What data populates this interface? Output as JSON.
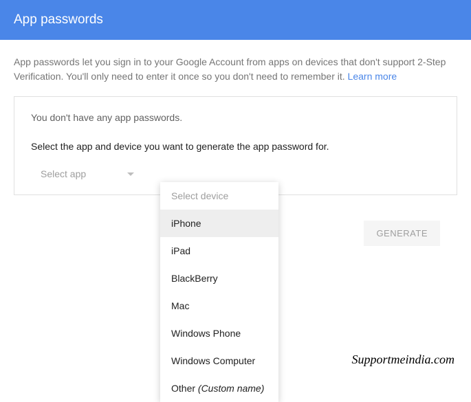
{
  "header": {
    "title": "App passwords"
  },
  "description": {
    "text": "App passwords let you sign in to your Google Account from apps on devices that don't support 2-Step Verification. You'll only need to enter it once so you don't need to remember it. ",
    "learn_more": "Learn more"
  },
  "card": {
    "no_passwords_msg": "You don't have any app passwords.",
    "instruction": "Select the app and device you want to generate the app password for.",
    "select_app_label": "Select app",
    "generate_button": "GENERATE"
  },
  "device_dropdown": {
    "placeholder": "Select device",
    "options": [
      "iPhone",
      "iPad",
      "BlackBerry",
      "Mac",
      "Windows Phone",
      "Windows Computer"
    ],
    "other_label": "Other ",
    "other_hint": "(Custom name)",
    "highlighted_index": 0
  },
  "watermark": "Supportmeindia.com"
}
